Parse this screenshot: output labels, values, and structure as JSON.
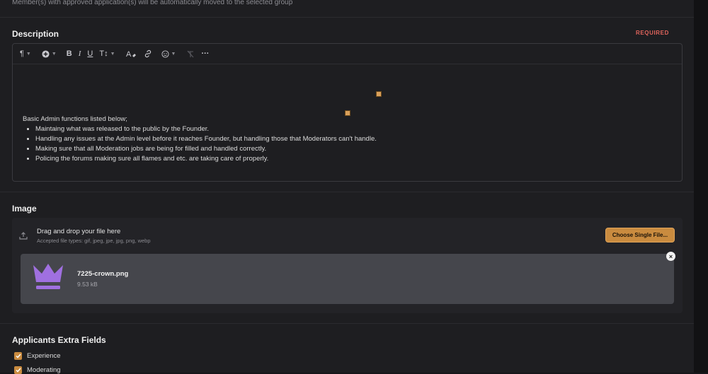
{
  "top_hint": "Member(s) with approved application(s) will be automatically moved to the selected group",
  "description": {
    "title": "Description",
    "required_label": "REQUIRED",
    "toolbar": {
      "bold": "B",
      "italic": "I",
      "underline": "U",
      "text_size": "T↕",
      "more": "···"
    },
    "intro": "Basic Admin functions listed below;",
    "bullets": [
      "Maintaing what was released to the public by the Founder.",
      "Handling any issues at the Admin level before it reaches Founder, but handling those that Moderators can't handle.",
      "Making sure that all Moderation jobs are being for filled and handled correctly.",
      "Policing the forums making sure all flames and etc. are taking care of properly."
    ]
  },
  "image": {
    "title": "Image",
    "drop_title": "Drag and drop your file here",
    "accepted": "Accepted file types: gif, jpeg, jpe, jpg, png, webp",
    "choose_button": "Choose Single File...",
    "file": {
      "name": "7225-crown.png",
      "size": "9.53 kB"
    },
    "remove": "×"
  },
  "extra_fields": {
    "title": "Applicants Extra Fields",
    "items": [
      {
        "label": "Experience",
        "checked": true
      },
      {
        "label": "Moderating",
        "checked": true
      }
    ]
  },
  "colors": {
    "accent": "#c98b3f",
    "required": "#e0645c",
    "crown": "#a070e0"
  }
}
